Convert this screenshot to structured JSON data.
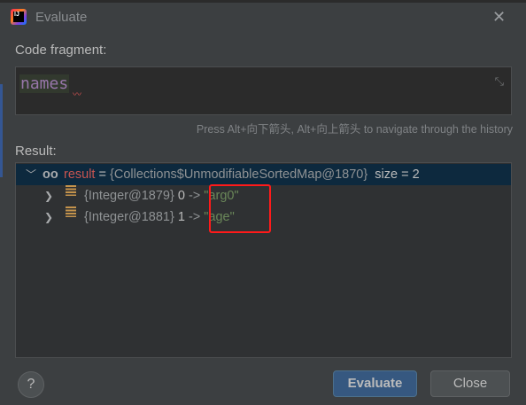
{
  "window": {
    "title": "Evaluate",
    "logo_text": "IJ"
  },
  "code_fragment": {
    "label": "Code fragment:",
    "value": "names"
  },
  "hint": "Press Alt+向下箭头, Alt+向上箭头 to navigate through the history",
  "result": {
    "label": "Result:",
    "root": {
      "name": "result",
      "eq": " = ",
      "type": "{Collections$UnmodifiableSortedMap@1870}",
      "size": "size = 2"
    },
    "children": [
      {
        "type": "{Integer@1879}",
        "key": "0",
        "arrow": " -> ",
        "value": "\"arg0\""
      },
      {
        "type": "{Integer@1881}",
        "key": "1",
        "arrow": " -> ",
        "value": "\"age\""
      }
    ]
  },
  "buttons": {
    "help": "?",
    "evaluate": "Evaluate",
    "close": "Close"
  },
  "colors": {
    "accent": "#365880",
    "highlight_box": "#ff1a1a",
    "string": "#6a8759",
    "variable": "#c75450"
  }
}
